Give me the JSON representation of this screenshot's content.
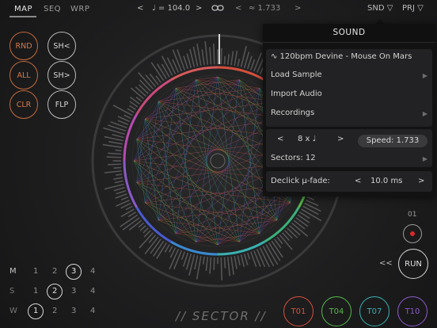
{
  "colors": {
    "accent_orange": "#c46a3c",
    "t01": "#d6503c",
    "t04": "#55b84a",
    "t07": "#3bb0b0",
    "t10": "#8a5ac8"
  },
  "topbar": {
    "tabs": [
      "MAP",
      "SEQ",
      "WRP"
    ],
    "prev": "<",
    "next": ">",
    "tempo_icon": "note-icon",
    "tempo": "♩ = 104.0",
    "link_icon": "link-icon",
    "swing_icon": "swing-icon",
    "swing": "≈ 1.733",
    "snd_label": "SND ▽",
    "prj_label": "PRJ ▽"
  },
  "left_buttons": [
    "RND",
    "SH<",
    "ALL",
    "SH>",
    "CLR",
    "FLP"
  ],
  "grid": {
    "rows": [
      {
        "label": "M",
        "values": [
          "1",
          "2",
          "3",
          "4"
        ],
        "selected": 2
      },
      {
        "label": "S",
        "values": [
          "1",
          "2",
          "3",
          "4"
        ],
        "selected": 1
      },
      {
        "label": "W",
        "values": [
          "1",
          "2",
          "3",
          "4"
        ],
        "selected": 0
      }
    ]
  },
  "tracks": [
    "T01",
    "T04",
    "T07",
    "T10"
  ],
  "transport": {
    "step_label": "01",
    "rewind": "<<",
    "run": "RUN"
  },
  "logo": "// SECTOR //",
  "panel": {
    "title": "SOUND",
    "sample_name": "∿ 120bpm Devine - Mouse On Mars",
    "load_sample": "Load Sample",
    "import_audio": "Import Audio",
    "recordings": "Recordings",
    "subdiv_prev": "<",
    "subdiv": "8 x ♩",
    "subdiv_next": ">",
    "speed": "Speed: 1.733",
    "sectors": "Sectors: 12",
    "declick_label": "Declick μ-fade:",
    "declick_prev": "<",
    "declick_value": "10.0 ms",
    "declick_next": ">"
  }
}
